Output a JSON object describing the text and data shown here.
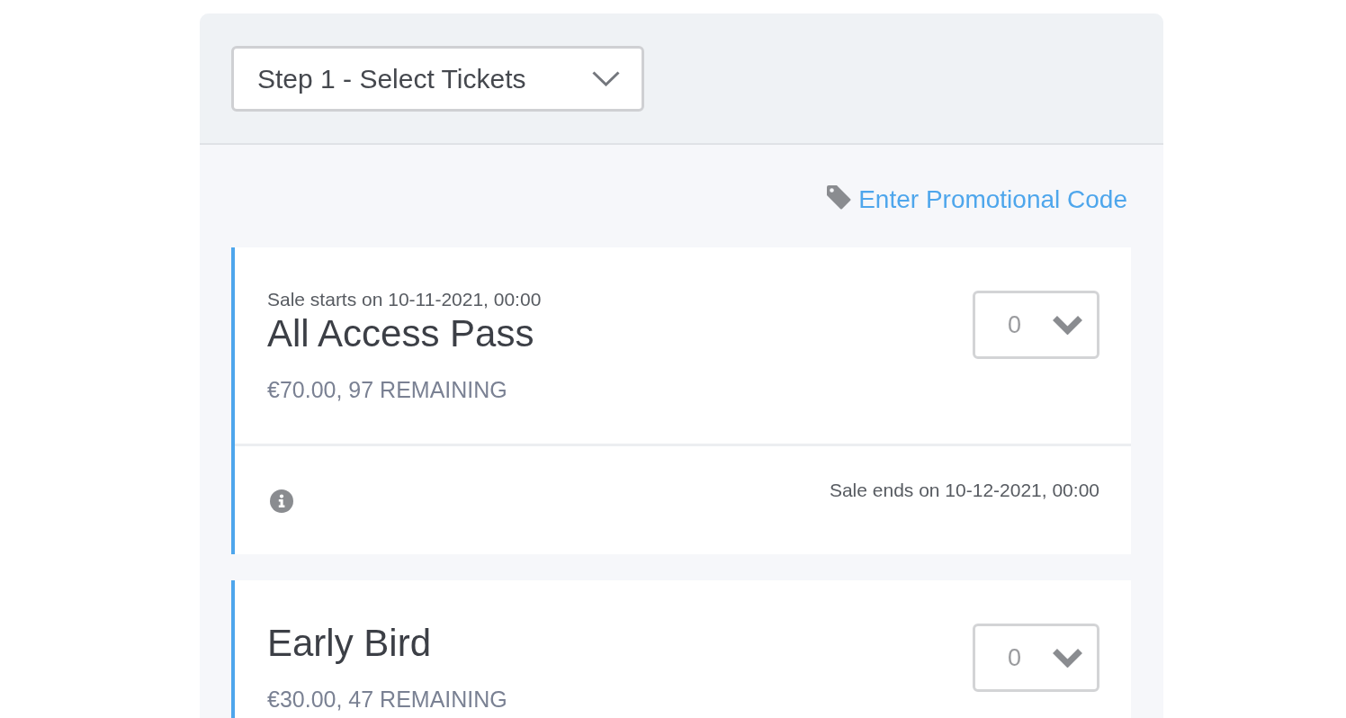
{
  "step_select": {
    "value": "Step 1 - Select Tickets"
  },
  "promo_link": {
    "label": "Enter Promotional Code"
  },
  "tickets": [
    {
      "sale_starts": "Sale starts on 10-11-2021, 00:00",
      "name": "All Access Pass",
      "price": "€70.00, 97 REMAINING",
      "quantity": "0",
      "sale_ends": "Sale ends on 10-12-2021, 00:00"
    },
    {
      "name": "Early Bird",
      "price": "€30.00, 47 REMAINING",
      "quantity": "0"
    }
  ]
}
